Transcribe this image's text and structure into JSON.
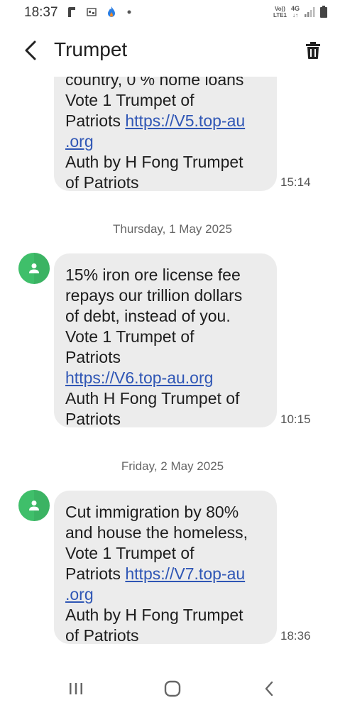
{
  "status_bar": {
    "time": "18:37",
    "volte": "Vo))",
    "lte": "LTE1",
    "network": "4G"
  },
  "header": {
    "title": "Trumpet"
  },
  "messages": [
    {
      "lines": [
        "country, 0 % home loans",
        "Vote 1 Trumpet of",
        "Patriots "
      ],
      "link": "https://V5.top-au",
      "link_cont": ".org",
      "tail": [
        "Auth by H Fong Trumpet",
        "of Patriots"
      ],
      "time": "15:14"
    },
    {
      "date": "Thursday, 1 May 2025",
      "lines": [
        "15% iron ore license fee",
        "repays our trillion dollars",
        "of debt, instead of you.",
        "Vote 1 Trumpet of",
        "Patriots"
      ],
      "link": "https://V6.top-au.org",
      "tail": [
        "Auth H Fong Trumpet of",
        "Patriots"
      ],
      "time": "10:15"
    },
    {
      "date": "Friday, 2 May 2025",
      "lines": [
        "Cut immigration by 80%",
        "and house the homeless,",
        "Vote 1 Trumpet of",
        "Patriots "
      ],
      "link": "https://V7.top-au",
      "link_cont": ".org",
      "tail": [
        "Auth by H Fong Trumpet",
        "of Patriots"
      ],
      "time": "18:36"
    }
  ],
  "colors": {
    "bubble": "#ececec",
    "link": "#2f56b5",
    "avatar": "#3fbf6a"
  }
}
